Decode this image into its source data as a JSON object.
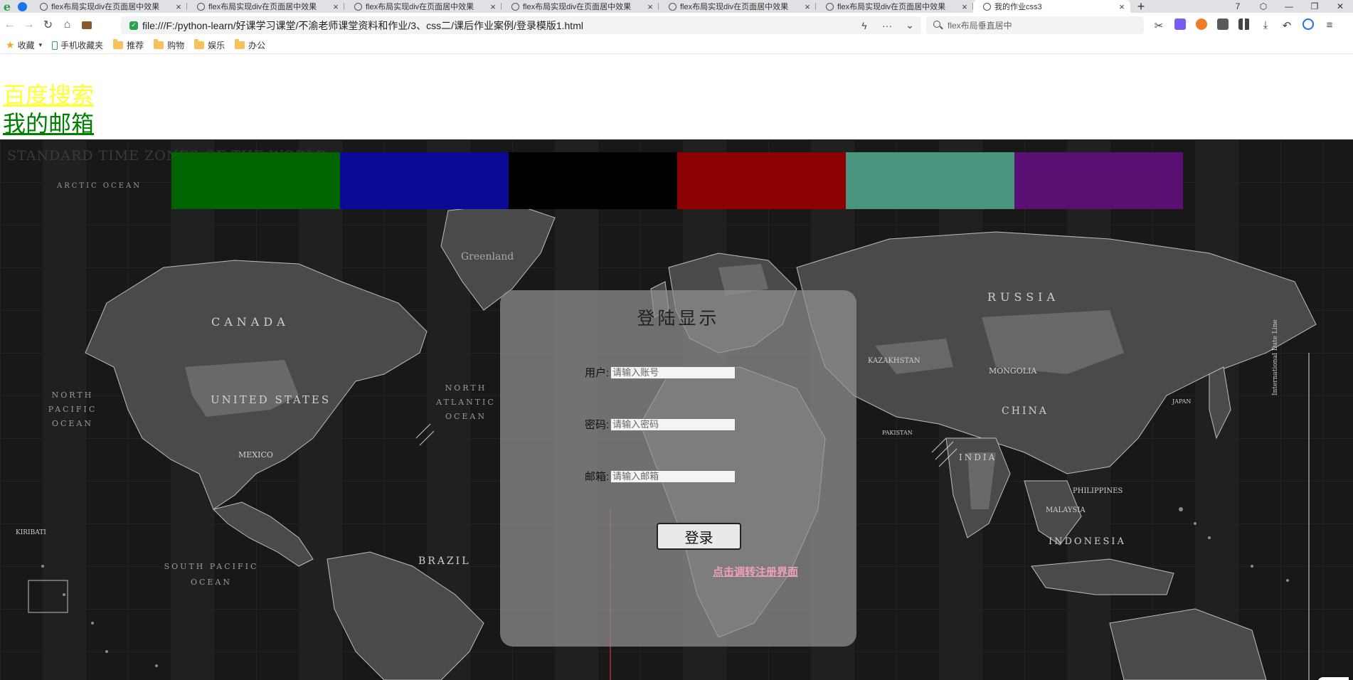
{
  "browser": {
    "tabs": [
      {
        "label": "flex布局实现div在页面居中效果"
      },
      {
        "label": "flex布局实现div在页面居中效果"
      },
      {
        "label": "flex布局实现div在页面居中效果"
      },
      {
        "label": "flex布局实现div在页面居中效果"
      },
      {
        "label": "flex布局实现div在页面居中效果"
      },
      {
        "label": "flex布局实现div在页面居中效果"
      },
      {
        "label": "我的作业css3",
        "active": true
      }
    ],
    "tab_close": "×",
    "new_tab": "+",
    "window_controls": [
      "7",
      "⬡",
      "—",
      "❐",
      "✕"
    ],
    "nav": {
      "back": "←",
      "forward": "→",
      "reload": "↻",
      "home": "⌂"
    },
    "url": "file:///F:/python-learn/好课学习课堂/不渝老师课堂资料和作业/3、css二/课后作业案例/登录模版1.html",
    "omni_icons": [
      "ϟ",
      "···",
      "⌄"
    ],
    "search_text": "flex布局垂直居中",
    "toolbar_icons": [
      "✂",
      "",
      "",
      "",
      "",
      "⤓",
      "↶",
      "",
      "≡"
    ],
    "bookmarks": [
      {
        "label": "收藏",
        "icon": "star-icon"
      },
      {
        "label": "手机收藏夹",
        "icon": "phone-icon"
      },
      {
        "label": "推荐",
        "icon": "folder-icon"
      },
      {
        "label": "购物",
        "icon": "folder-icon"
      },
      {
        "label": "娱乐",
        "icon": "folder-icon"
      },
      {
        "label": "办公",
        "icon": "folder-icon"
      }
    ],
    "bookmark_caret": "▾"
  },
  "page": {
    "links": {
      "baidu": "百度搜索",
      "mail": "我的邮箱"
    },
    "map": {
      "title": "STANDARD TIME ZONES OF THE WORLD",
      "labels": {
        "russia": "RUSSIA",
        "canada": "CANADA",
        "us": "UNITED STATES",
        "china": "CHINA",
        "brazil": "BRAZIL",
        "india": "INDIA",
        "indonesia": "INDONESIA",
        "mongolia": "MONGOLIA",
        "kazakhstan": "KAZAKHSTAN",
        "greenland": "Greenland",
        "mexico": "MEXICO",
        "north_pacific": "NORTH PACIFIC OCEAN",
        "north_atlantic": "NORTH ATLANTIC OCEAN",
        "south_pacific": "SOUTH PACIFIC OCEAN",
        "arctic": "ARCTIC OCEAN",
        "philippines": "PHILIPPINES",
        "malaysia": "MALAYSIA",
        "kiribati": "KIRIBATI",
        "pakistan": "PAKISTAN",
        "japan": "JAPAN",
        "international_date_line": "International Date Line"
      }
    },
    "colors": {
      "box_colors": [
        "#006400",
        "#0a0a96",
        "#000000",
        "#8b0000",
        "#4a9480",
        "#5a0f73"
      ],
      "baidu_link": "#ffff33",
      "mail_link": "#008000",
      "register_link": "#f0a0b5"
    },
    "login": {
      "title": "登陆显示",
      "username_label": "用户:",
      "username_placeholder": "请输入账号",
      "password_label": "密码:",
      "password_placeholder": "请输入密码",
      "email_label": "邮箱:",
      "email_placeholder": "请输入邮箱",
      "submit": "登录",
      "register": "点击调转注册界面"
    }
  }
}
